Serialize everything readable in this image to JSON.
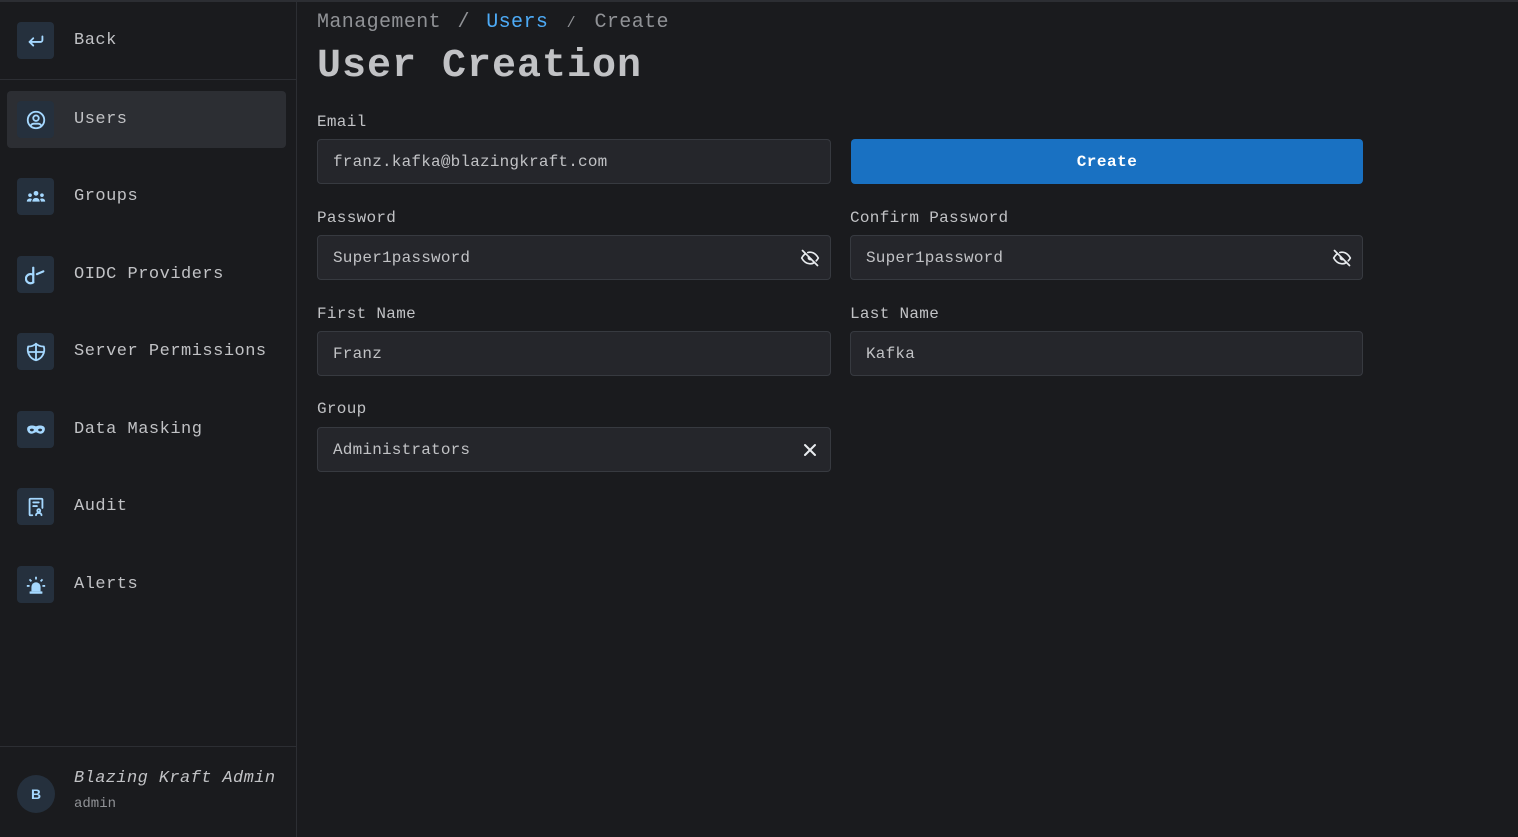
{
  "sidebar": {
    "back_label": "Back",
    "items": [
      {
        "label": "Users",
        "icon": "user-circle-icon",
        "active": true
      },
      {
        "label": "Groups",
        "icon": "users-group-icon"
      },
      {
        "label": "OIDC Providers",
        "icon": "brand-oauth-icon"
      },
      {
        "label": "Server Permissions",
        "icon": "shield-half-icon"
      },
      {
        "label": "Data Masking",
        "icon": "mask-icon"
      },
      {
        "label": "Audit",
        "icon": "report-icon"
      },
      {
        "label": "Alerts",
        "icon": "alarm-light-icon"
      }
    ],
    "user": {
      "initial": "B",
      "name": "Blazing Kraft Admin",
      "role": "admin"
    }
  },
  "breadcrumb": {
    "root": "Management",
    "sep1": "/",
    "users": "Users",
    "sep2": "/",
    "current": "Create"
  },
  "page_title": "User Creation",
  "form": {
    "email_label": "Email",
    "email_value": "franz.kafka@blazingkraft.com",
    "create_label": "Create",
    "password_label": "Password",
    "password_value": "Super1password",
    "confirm_password_label": "Confirm Password",
    "confirm_password_value": "Super1password",
    "first_name_label": "First Name",
    "first_name_value": "Franz",
    "last_name_label": "Last Name",
    "last_name_value": "Kafka",
    "group_label": "Group",
    "group_value": "Administrators"
  },
  "colors": {
    "background": "#1a1b1e",
    "accent": "#1971c2",
    "link": "#4dabf7",
    "icon_bg": "#25303d",
    "icon_fg": "#a5d8ff"
  }
}
